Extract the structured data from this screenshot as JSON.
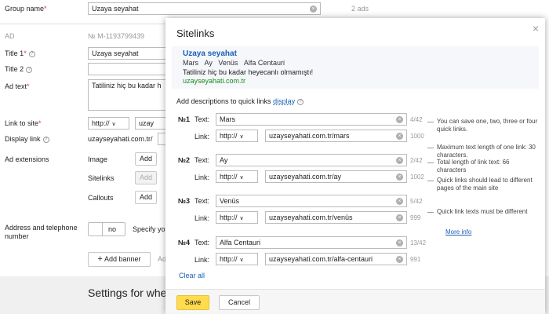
{
  "form": {
    "group_name_label": "Group name",
    "group_name_value": "Uzaya seyahat",
    "ads_count": "2 ads",
    "ad_label": "AD",
    "ad_number": "№ M-1193799439",
    "title1_label": "Title 1",
    "title1_value": "Uzaya seyahat",
    "title2_label": "Title 2",
    "ad_text_label": "Ad text",
    "ad_text_value": "Tatiliniz hiç bu kadar h",
    "link_label": "Link to site",
    "link_protocol": "http://",
    "link_value": "uzay",
    "display_link_label": "Display link",
    "display_link_value": "uzayseyahati.com.tr/",
    "ad_extensions_label": "Ad extensions",
    "image_label": "Image",
    "image_add": "Add",
    "sitelinks_label": "Sitelinks",
    "sitelinks_add": "Add",
    "callouts_label": "Callouts",
    "callouts_add": "Add",
    "address_label": "Address and telephone number",
    "toggle_value": "no",
    "specify_text": "Specify yo",
    "add_banner": "Add banner",
    "add_more": "Ad",
    "settings_text": "Settings for whe"
  },
  "modal": {
    "title": "Sitelinks",
    "preview": {
      "headline": "Uzaya seyahat",
      "links": [
        "Mars",
        "Ay",
        "Venüs",
        "Alfa Centauri"
      ],
      "text": "Tatiliniz hiç bu kadar heyecanlı olmamıştı!",
      "url": "uzayseyahati.com.tr"
    },
    "add_desc_text": "Add descriptions to quick links",
    "display_link": "display",
    "text_label": "Text:",
    "link_label": "Link:",
    "protocol": "http://",
    "sitelinks": [
      {
        "num": "№1",
        "text": "Mars",
        "text_count": "4/42",
        "url": "uzayseyahati.com.tr/mars",
        "url_count": "1000"
      },
      {
        "num": "№2",
        "text": "Ay",
        "text_count": "2/42",
        "url": "uzayseyahati.com.tr/ay",
        "url_count": "1002"
      },
      {
        "num": "№3",
        "text": "Venüs",
        "text_count": "5/42",
        "url": "uzayseyahati.com.tr/venüs",
        "url_count": "999"
      },
      {
        "num": "№4",
        "text": "Alfa Centauri",
        "text_count": "13/42",
        "url": "uzayseyahati.com.tr/alfa-centauri",
        "url_count": "991"
      }
    ],
    "tips": [
      "You can save one, two, three or four quick links.",
      "Maximum text length of one link: 30 characters.",
      "Total length of link text: 66 characters",
      "Quick links should lead to different pages of the main site",
      "Quick link texts must be different"
    ],
    "more_info": "More info",
    "clear_all": "Clear all",
    "save": "Save",
    "cancel": "Cancel",
    "close_glyph": "×"
  },
  "colors": {
    "save_button": "#ffdb4d",
    "link": "#1a5fb4",
    "url_green": "#1a8a1a"
  }
}
